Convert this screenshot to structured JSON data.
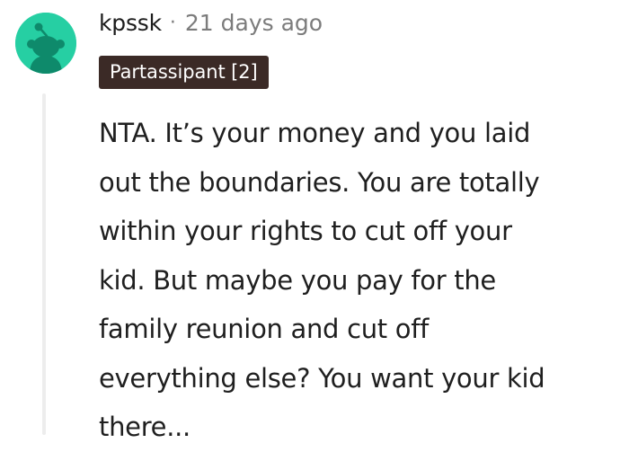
{
  "comment": {
    "username": "kpssk",
    "separator": "·",
    "timestamp": "21 days ago",
    "flair": "Partassipant [2]",
    "avatar_icon": "snoo-avatar-icon",
    "avatar_color": "#26cfa3",
    "flair_color": "#3b2a26",
    "body_lines": [
      "NTA. It’s your money and you laid",
      "out the boundaries. You are totally",
      "within your rights to cut off your",
      "kid. But maybe you pay for the",
      "family reunion and cut off",
      "everything else? You want your kid",
      "there..."
    ]
  }
}
